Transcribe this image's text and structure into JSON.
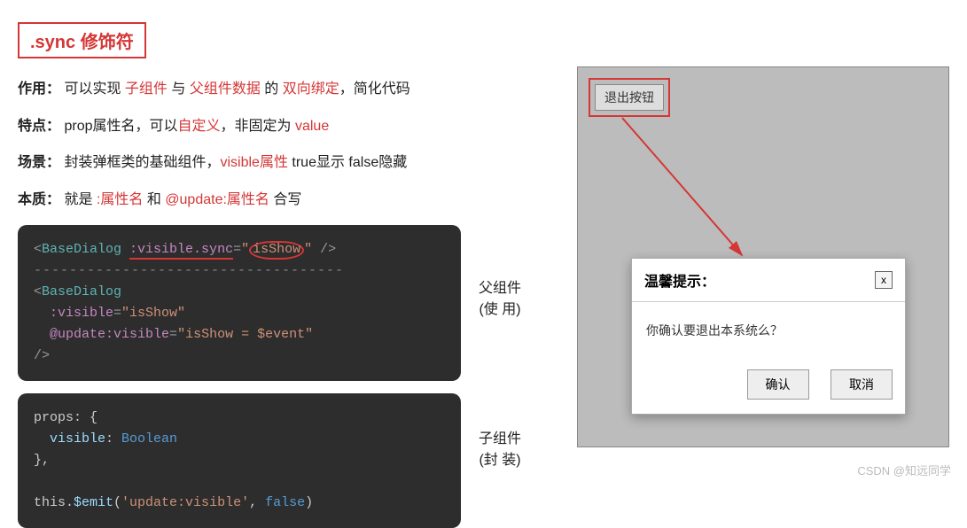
{
  "title": ".sync 修饰符",
  "lines": {
    "purpose_label": "作用：",
    "purpose_pre": "可以实现 ",
    "purpose_r1": "子组件",
    "purpose_mid1": " 与 ",
    "purpose_r2": "父组件数据",
    "purpose_mid2": " 的 ",
    "purpose_r3": "双向绑定",
    "purpose_post": "，简化代码",
    "trait_label": "特点：",
    "trait_pre": "prop属性名，可以",
    "trait_r1": "自定义",
    "trait_mid": "，非固定为 ",
    "trait_r2": "value",
    "scene_label": "场景：",
    "scene_pre": "封装弹框类的基础组件，",
    "scene_r1": "visible属性",
    "scene_post": " true显示 false隐藏",
    "essence_label": "本质：",
    "essence_pre": "就是 ",
    "essence_r1": ":属性名",
    "essence_mid": " 和 ",
    "essence_r2": "@update:属性名",
    "essence_post": " 合写"
  },
  "code1": {
    "l1_open": "<",
    "l1_tag": "BaseDialog",
    "l1_sp": " ",
    "l1_attr": ":visible.sync",
    "l1_eq": "=",
    "l1_q1": "\"",
    "l1_str": "isShow",
    "l1_q2": "\"",
    "l1_close": " />",
    "dashes": "-----------------------------------",
    "l2_open": "<",
    "l2_tag": "BaseDialog",
    "l3_pad": "  ",
    "l3_attr": ":visible",
    "l3_eq": "=",
    "l3_str": "\"isShow\"",
    "l4_pad": "  ",
    "l4_attr": "@update:visible",
    "l4_eq": "=",
    "l4_str": "\"isShow = $event\"",
    "l5": "/>"
  },
  "code2": {
    "l1": "props: {",
    "l2_pad": "  ",
    "l2_key": "visible",
    "l2_colon": ": ",
    "l2_type": "Boolean",
    "l3": "},",
    "blank": "",
    "l4_pre": "this.",
    "l4_emit": "$emit",
    "l4_open": "(",
    "l4_str": "'update:visible'",
    "l4_sep": ", ",
    "l4_val": "false",
    "l4_close": ")"
  },
  "annot1_a": "父组件",
  "annot1_b": "(使 用)",
  "annot2_a": "子组件",
  "annot2_b": "(封 装)",
  "demo": {
    "exit_btn": "退出按钮",
    "dialog_title": "温馨提示：",
    "dialog_close": "x",
    "dialog_body": "你确认要退出本系统么？",
    "ok": "确认",
    "cancel": "取消"
  },
  "watermark": "CSDN @知远同学"
}
